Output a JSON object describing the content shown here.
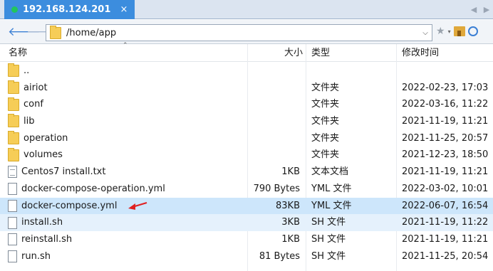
{
  "tab": {
    "title": "192.168.124.201",
    "close": "×"
  },
  "tab_nav": {
    "prev": "◀",
    "next": "▶"
  },
  "toolbar": {
    "back": "🡐",
    "forward": "🡒",
    "path": "/home/app",
    "dropdown": "⌵",
    "star": "★",
    "star_dropdown": "▾"
  },
  "columns": {
    "name": "名称",
    "size": "大小",
    "type": "类型",
    "modified": "修改时间"
  },
  "files": [
    {
      "name": "..",
      "size": "",
      "type": "",
      "modified": "",
      "icon": "folder-icon"
    },
    {
      "name": "airiot",
      "size": "",
      "type": "文件夹",
      "modified": "2022-02-23, 17:03",
      "icon": "folder-icon"
    },
    {
      "name": "conf",
      "size": "",
      "type": "文件夹",
      "modified": "2022-03-16, 11:22",
      "icon": "folder-icon"
    },
    {
      "name": "lib",
      "size": "",
      "type": "文件夹",
      "modified": "2021-11-19, 11:21",
      "icon": "folder-icon"
    },
    {
      "name": "operation",
      "size": "",
      "type": "文件夹",
      "modified": "2021-11-25, 20:57",
      "icon": "folder-icon"
    },
    {
      "name": "volumes",
      "size": "",
      "type": "文件夹",
      "modified": "2021-12-23, 18:50",
      "icon": "folder-icon"
    },
    {
      "name": "Centos7 install.txt",
      "size": "1KB",
      "type": "文本文档",
      "modified": "2021-11-19, 11:21",
      "icon": "text-file-icon"
    },
    {
      "name": "docker-compose-operation.yml",
      "size": "790 Bytes",
      "type": "YML 文件",
      "modified": "2022-03-02, 10:01",
      "icon": "file-icon"
    },
    {
      "name": "docker-compose.yml",
      "size": "83KB",
      "type": "YML 文件",
      "modified": "2022-06-07, 16:54",
      "icon": "file-icon",
      "state": "selected"
    },
    {
      "name": "install.sh",
      "size": "3KB",
      "type": "SH 文件",
      "modified": "2021-11-19, 11:22",
      "icon": "file-icon",
      "state": "hover"
    },
    {
      "name": "reinstall.sh",
      "size": "1KB",
      "type": "SH 文件",
      "modified": "2021-11-19, 11:21",
      "icon": "file-icon"
    },
    {
      "name": "run.sh",
      "size": "81 Bytes",
      "type": "SH 文件",
      "modified": "2021-11-25, 20:54",
      "icon": "file-icon"
    }
  ],
  "colors": {
    "tab_active": "#3c8dde",
    "selection": "#cde6fb",
    "annotation_arrow": "#e02020"
  }
}
